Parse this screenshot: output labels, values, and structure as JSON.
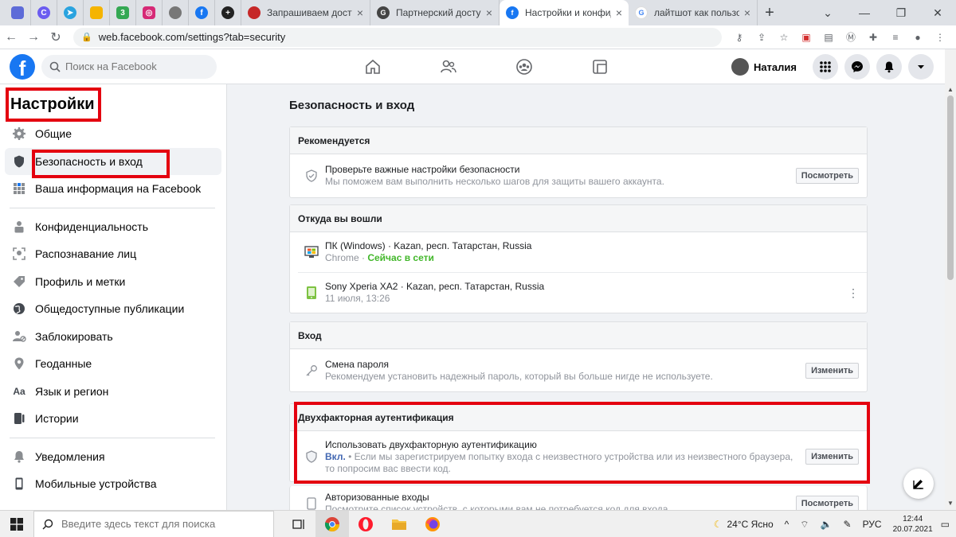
{
  "browser": {
    "tabs": [
      {
        "title": "Запрашиваем доступ",
        "color": "#c62828",
        "glyph": "🍒"
      },
      {
        "title": "Партнерский доступ к",
        "color": "#444",
        "glyph": "G"
      },
      {
        "title": "Настройки и конфиде",
        "color": "#1877f2",
        "glyph": "f",
        "active": true
      },
      {
        "title": "лайтшот как пользова",
        "color": "#4285f4",
        "glyph": "G"
      }
    ],
    "pinned_glyph_badge": "3",
    "url": "web.facebook.com/settings?tab=security"
  },
  "header": {
    "search_placeholder": "Поиск на Facebook",
    "user_name": "Наталия"
  },
  "sidebar": {
    "title": "Настройки",
    "groups": [
      [
        {
          "label": "Общие",
          "icon": "gear-icon"
        },
        {
          "label": "Безопасность и вход",
          "icon": "shield-icon",
          "selected": true
        },
        {
          "label": "Ваша информация на Facebook",
          "icon": "grid-icon"
        }
      ],
      [
        {
          "label": "Конфиденциальность",
          "icon": "lock-icon"
        },
        {
          "label": "Распознавание лиц",
          "icon": "face-icon"
        },
        {
          "label": "Профиль и метки",
          "icon": "tag-icon"
        },
        {
          "label": "Общедоступные публикации",
          "icon": "globe-icon"
        },
        {
          "label": "Заблокировать",
          "icon": "block-user-icon"
        },
        {
          "label": "Геоданные",
          "icon": "location-icon"
        },
        {
          "label": "Язык и регион",
          "icon": "language-icon"
        },
        {
          "label": "Истории",
          "icon": "stories-icon"
        }
      ],
      [
        {
          "label": "Уведомления",
          "icon": "bell-icon"
        },
        {
          "label": "Мобильные устройства",
          "icon": "mobile-icon"
        }
      ]
    ]
  },
  "main": {
    "title": "Безопасность и вход",
    "recommended": {
      "header": "Рекомендуется",
      "title": "Проверьте важные настройки безопасности",
      "sub": "Мы поможем вам выполнить несколько шагов для защиты вашего аккаунта.",
      "button": "Посмотреть"
    },
    "logged_in": {
      "header": "Откуда вы вошли",
      "sessions": [
        {
          "title": "ПК (Windows) · Kazan, респ. Татарстан, Russia",
          "sub": "Chrome · ",
          "status": "Сейчас в сети"
        },
        {
          "title": "Sony Xperia XA2 · Kazan, респ. Татарстан, Russia",
          "sub": "11 июля, 13:26",
          "status": ""
        }
      ]
    },
    "login": {
      "header": "Вход",
      "title": "Смена пароля",
      "sub": "Рекомендуем установить надежный пароль, который вы больше нигде не используете.",
      "button": "Изменить"
    },
    "twofa": {
      "header": "Двухфакторная аутентификация",
      "title": "Использовать двухфакторную аутентификацию",
      "on": "Вкл.",
      "sub": " • Если мы зарегистрируем попытку входа с неизвестного устройства или из неизвестного браузера, то попросим вас ввести код.",
      "button": "Изменить"
    },
    "authorized": {
      "title": "Авторизованные входы",
      "sub": "Посмотрите список устройств, с которыми вам не потребуется код для входа.",
      "button": "Посмотреть"
    }
  },
  "taskbar": {
    "search_placeholder": "Введите здесь текст для поиска",
    "weather": "24°C  Ясно",
    "lang": "РУС",
    "time": "12:44",
    "date": "20.07.2021"
  },
  "colors": {
    "facebook_blue": "#1877f2",
    "highlight_red": "#e4000f",
    "online_green": "#42b72a"
  }
}
